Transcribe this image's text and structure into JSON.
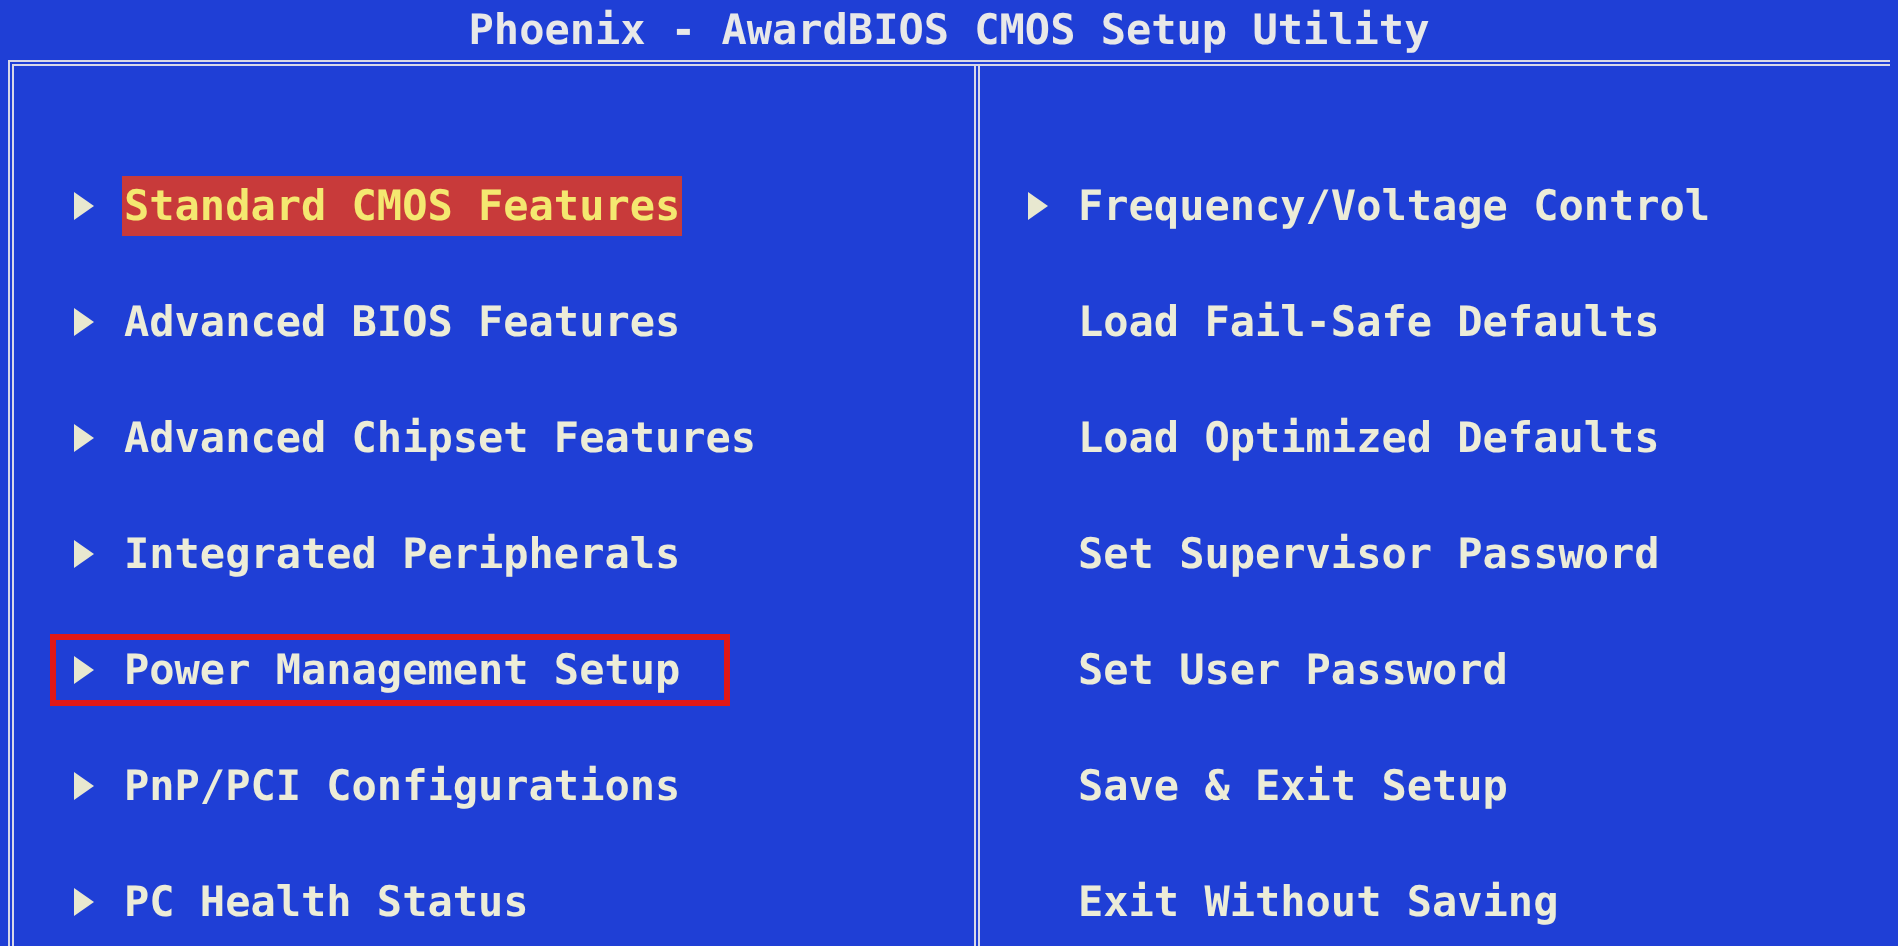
{
  "window": {
    "title": "Phoenix - AwardBIOS CMOS Setup Utility"
  },
  "left_menu": [
    {
      "label": "Standard CMOS Features",
      "kind": "submenu",
      "selected": true,
      "outlined": false
    },
    {
      "label": "Advanced BIOS Features",
      "kind": "submenu",
      "selected": false,
      "outlined": false
    },
    {
      "label": "Advanced Chipset Features",
      "kind": "submenu",
      "selected": false,
      "outlined": false
    },
    {
      "label": "Integrated Peripherals",
      "kind": "submenu",
      "selected": false,
      "outlined": false
    },
    {
      "label": "Power Management Setup",
      "kind": "submenu",
      "selected": false,
      "outlined": true
    },
    {
      "label": "PnP/PCI Configurations",
      "kind": "submenu",
      "selected": false,
      "outlined": false
    },
    {
      "label": "PC Health Status",
      "kind": "submenu",
      "selected": false,
      "outlined": false
    }
  ],
  "right_menu": [
    {
      "label": "Frequency/Voltage Control",
      "kind": "submenu",
      "selected": false,
      "outlined": false
    },
    {
      "label": "Load Fail-Safe Defaults",
      "kind": "action",
      "selected": false,
      "outlined": false
    },
    {
      "label": "Load Optimized Defaults",
      "kind": "action",
      "selected": false,
      "outlined": false
    },
    {
      "label": "Set Supervisor Password",
      "kind": "action",
      "selected": false,
      "outlined": false
    },
    {
      "label": "Set User Password",
      "kind": "action",
      "selected": false,
      "outlined": false
    },
    {
      "label": "Save & Exit Setup",
      "kind": "action",
      "selected": false,
      "outlined": false
    },
    {
      "label": "Exit Without Saving",
      "kind": "action",
      "selected": false,
      "outlined": false
    }
  ]
}
